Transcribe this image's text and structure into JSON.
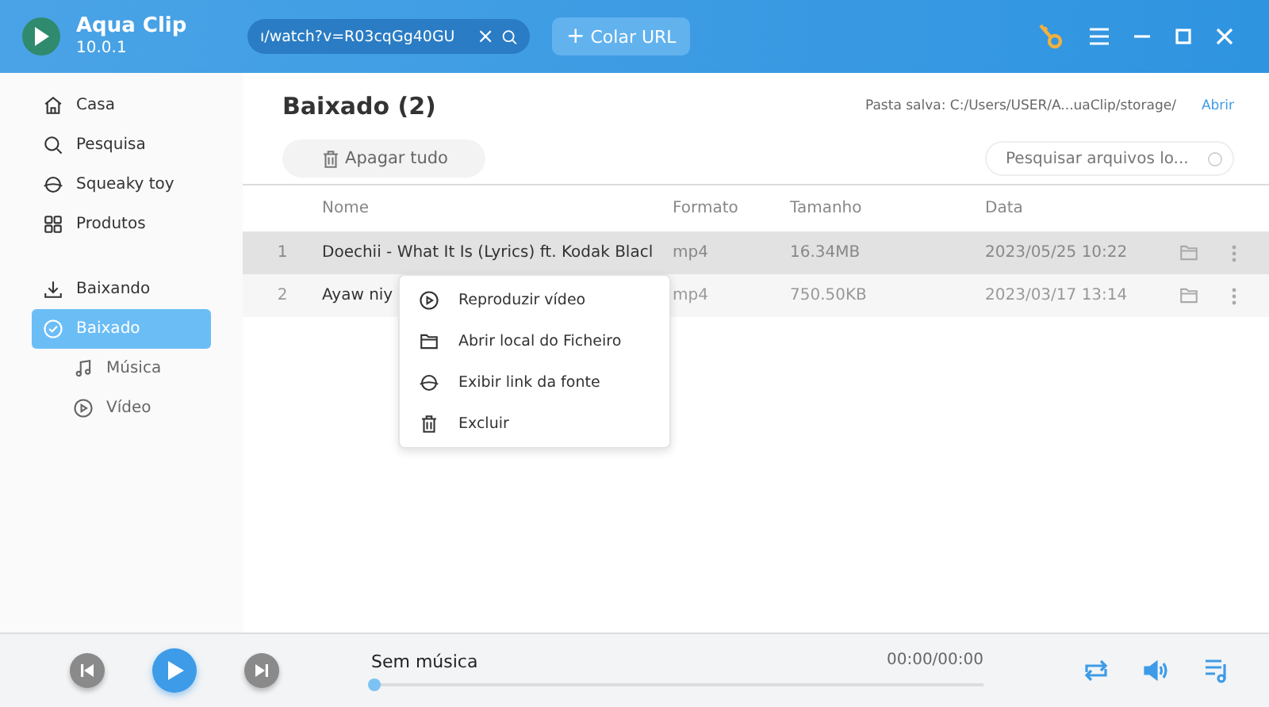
{
  "app": {
    "name": "Aqua Clip",
    "version": "10.0.1"
  },
  "url_field": {
    "value": "ı/watch?v=R03cqGg40GU",
    "clear": "×"
  },
  "paste_button": {
    "icon": "+",
    "label": "Colar URL"
  },
  "sidebar": {
    "groups": [
      [
        {
          "label": "Casa",
          "selected": false
        },
        {
          "label": "Pesquisa",
          "selected": false
        },
        {
          "label": "Squeaky toy",
          "selected": false
        },
        {
          "label": "Produtos",
          "selected": false
        }
      ],
      [
        {
          "label": "Baixando",
          "selected": false
        },
        {
          "label": "Baixado",
          "selected": true,
          "children": [
            {
              "label": "Música",
              "selected": false
            },
            {
              "label": "Vídeo",
              "selected": false
            }
          ]
        }
      ]
    ]
  },
  "main": {
    "title": "Baixado (2)",
    "save_label": "Pasta salva: C:/Users/USER/A...uaClip/storage/",
    "open_link": "Abrir",
    "delete_all": "Apagar tudo",
    "search": {
      "placeholder": "Pesquisar arquivos lo..."
    }
  },
  "table": {
    "columns": [
      "Nome",
      "Formato",
      "Tamanho",
      "Data"
    ],
    "rows": [
      {
        "index": "1",
        "name": "Doechii - What It Is (Lyrics) ft. Kodak Blacl",
        "format": "mp4",
        "size": "16.34MB",
        "date": "2023/05/25 10:22",
        "selected": true
      },
      {
        "index": "2",
        "name": "Ayaw niy",
        "format": "mp4",
        "size": "750.50KB",
        "date": "2023/03/17 13:14",
        "selected": false
      }
    ]
  },
  "context_menu": [
    {
      "label": "Reproduzir vídeo"
    },
    {
      "label": "Abrir local do Ficheiro"
    },
    {
      "label": "Exibir link da fonte"
    },
    {
      "label": "Excluir"
    }
  ],
  "player": {
    "track": "Sem música",
    "time": "00:00/00:00",
    "level": 0
  }
}
